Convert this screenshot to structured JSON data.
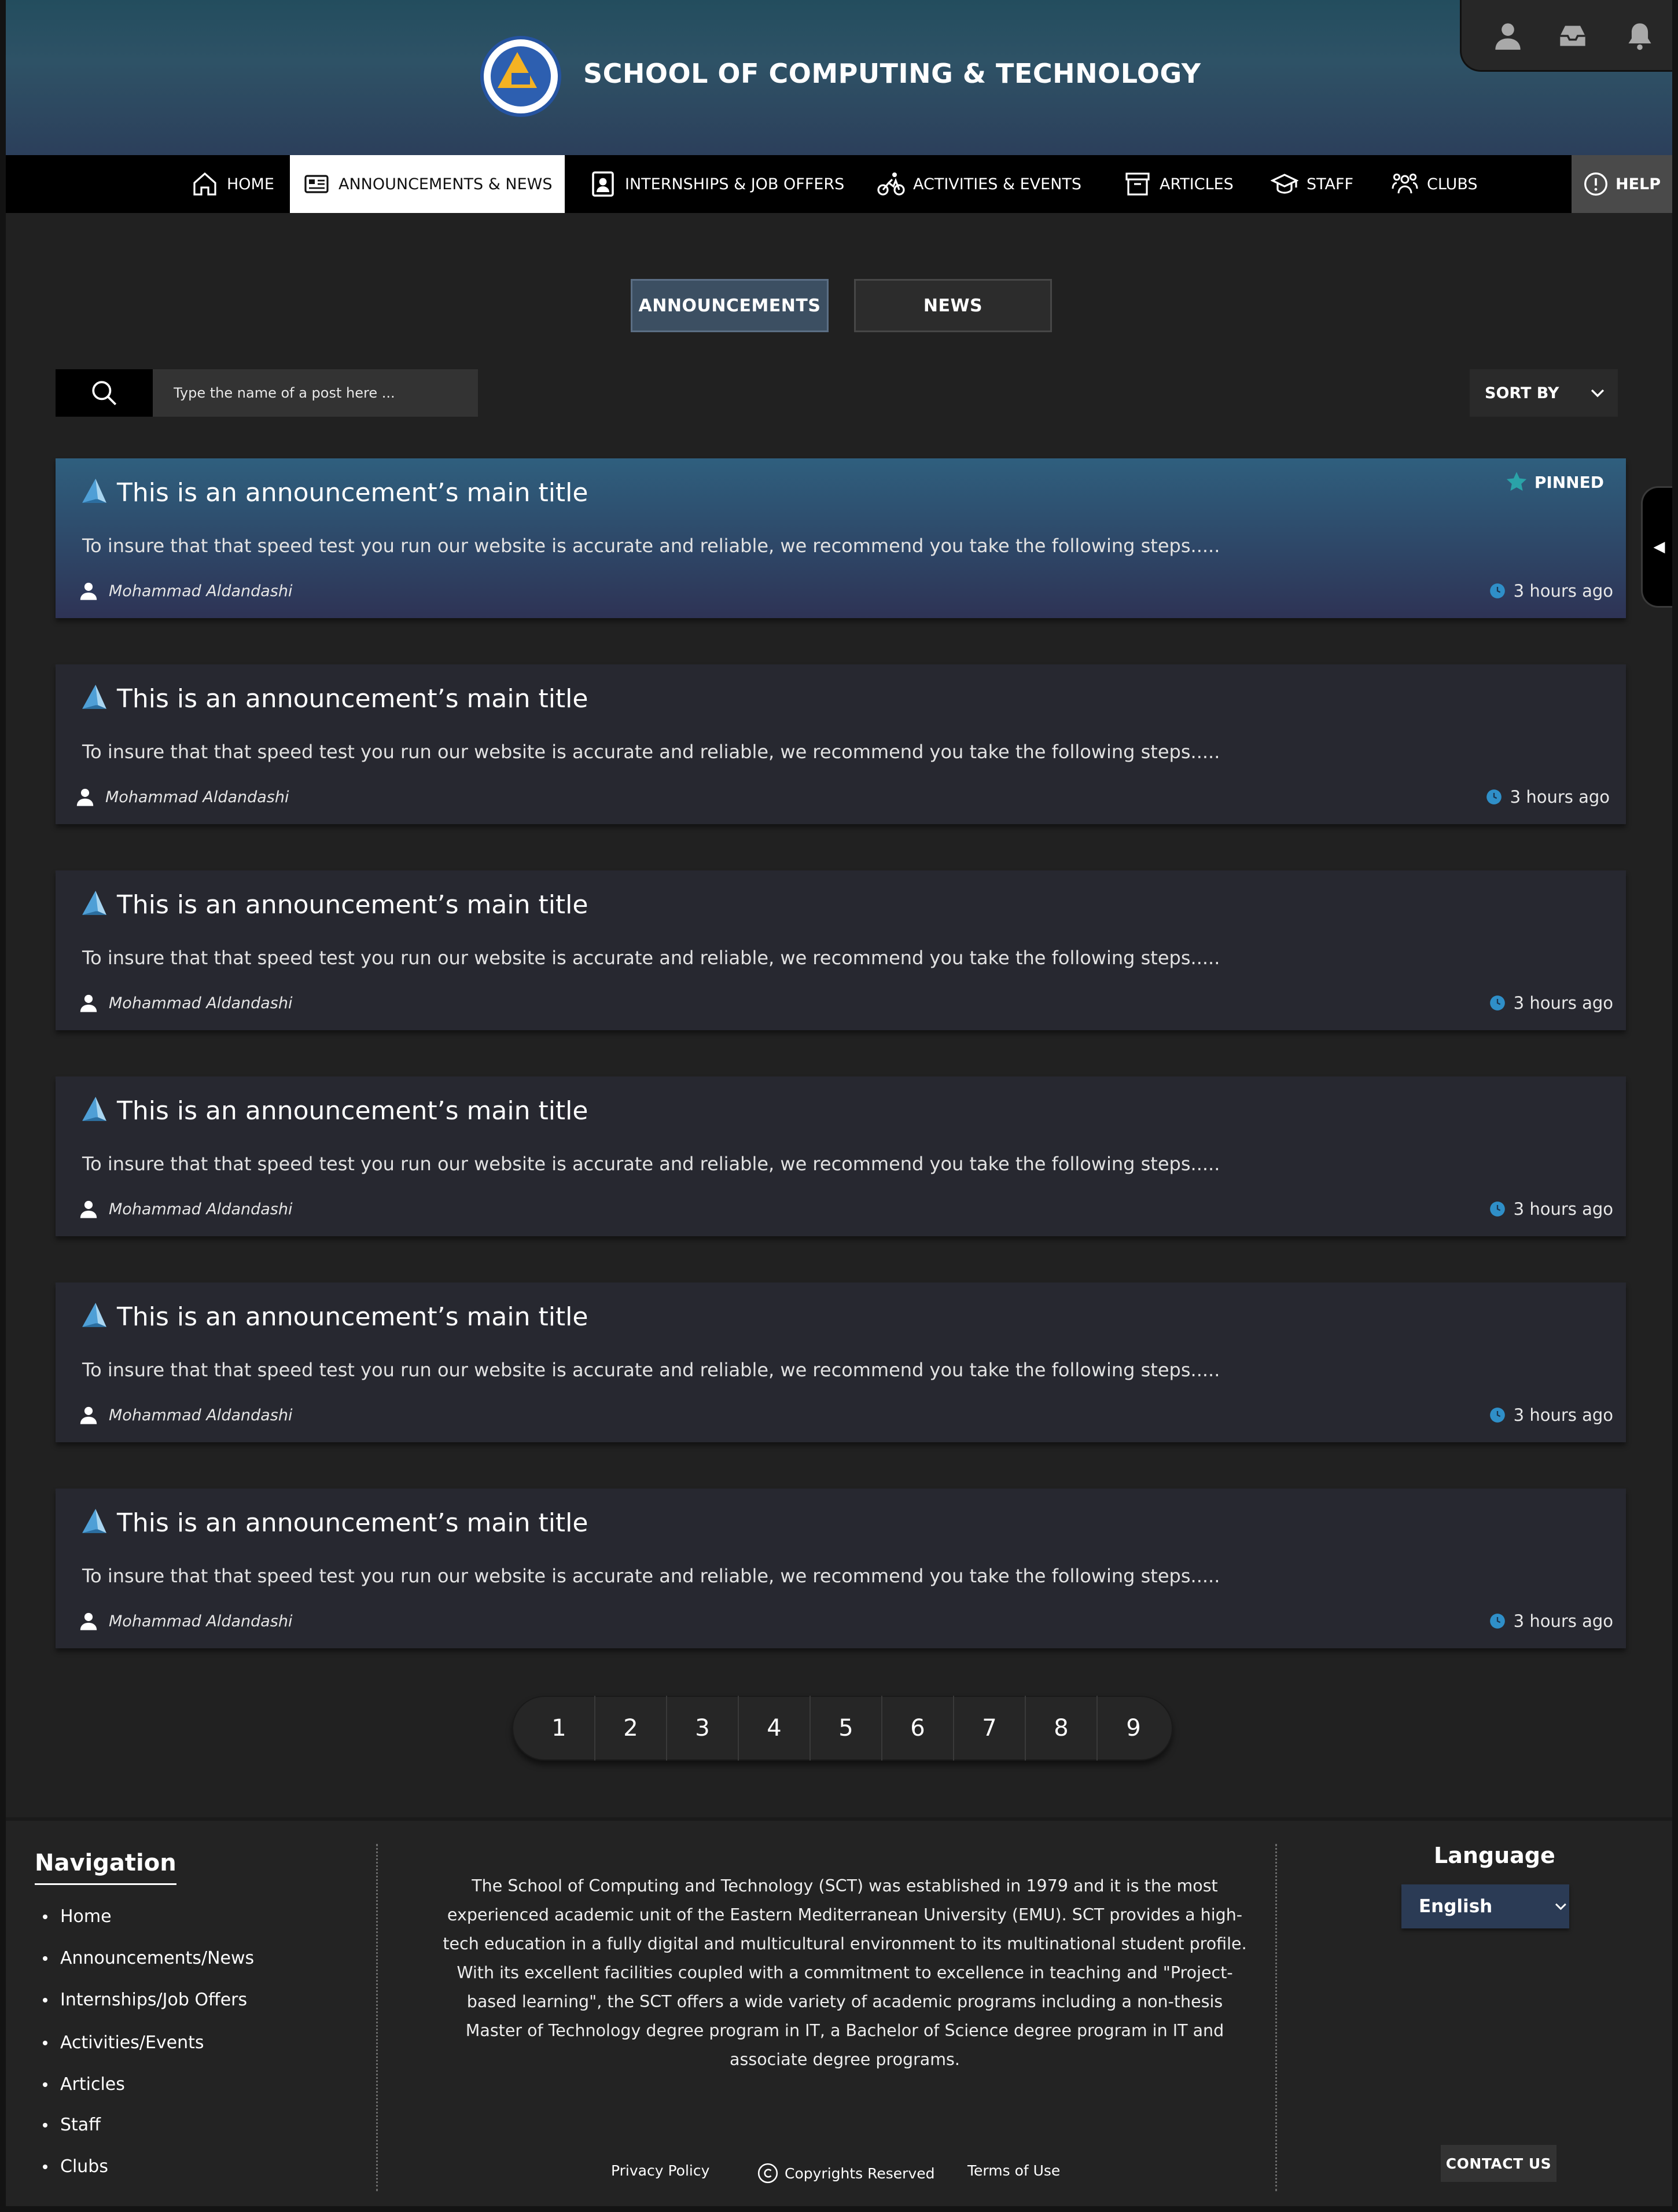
{
  "header": {
    "site_title": "SCHOOL OF COMPUTING & TECHNOLOGY",
    "logo_icon": "school-emblem-icon",
    "utility_icons": [
      "user-icon",
      "inbox-icon",
      "bell-icon"
    ]
  },
  "nav": {
    "items": [
      {
        "label": "HOME",
        "icon": "home-icon"
      },
      {
        "label": "ANNOUNCEMENTS & NEWS",
        "icon": "newspaper-icon",
        "active": true
      },
      {
        "label": "INTERNSHIPS & JOB OFFERS",
        "icon": "id-badge-icon"
      },
      {
        "label": "ACTIVITIES & EVENTS",
        "icon": "cyclist-icon"
      },
      {
        "label": "ARTICLES",
        "icon": "archive-icon"
      },
      {
        "label": "STAFF",
        "icon": "graduation-cap-icon"
      },
      {
        "label": "CLUBS",
        "icon": "group-icon"
      }
    ],
    "help_label": "HELP"
  },
  "tabs": {
    "announcements": "ANNOUNCEMENTS",
    "news": "NEWS",
    "active": "announcements"
  },
  "search": {
    "placeholder": "Type the name of a post here ...",
    "value": ""
  },
  "sort": {
    "label": "SORT BY"
  },
  "posts": [
    {
      "title": "This is an announcement’s main title",
      "body": "To insure that that speed test you run our website is accurate and reliable, we recommend you take the following steps.....",
      "author": "Mohammad Aldandashi",
      "time": "3 hours ago",
      "pinned": true,
      "pinned_label": "PINNED"
    },
    {
      "title": "This is an announcement’s main title",
      "body": "To insure that that speed test you run our website is accurate and reliable, we recommend you take the following steps.....",
      "author": "Mohammad Aldandashi",
      "time": "3 hours ago"
    },
    {
      "title": "This is an announcement’s main title",
      "body": "To insure that that speed test you run our website is accurate and reliable, we recommend you take the following steps.....",
      "author": "Mohammad Aldandashi",
      "time": "3 hours ago"
    },
    {
      "title": "This is an announcement’s main title",
      "body": "To insure that that speed test you run our website is accurate and reliable, we recommend you take the following steps.....",
      "author": "Mohammad Aldandashi",
      "time": "3 hours ago"
    },
    {
      "title": "This is an announcement’s main title",
      "body": "To insure that that speed test you run our website is accurate and reliable, we recommend you take the following steps.....",
      "author": "Mohammad Aldandashi",
      "time": "3 hours ago"
    },
    {
      "title": "This is an announcement’s main title",
      "body": "To insure that that speed test you run our website is accurate and reliable, we recommend you take the following steps.....",
      "author": "Mohammad Aldandashi",
      "time": "3 hours ago"
    }
  ],
  "pagination": {
    "pages": [
      "1",
      "2",
      "3",
      "4",
      "5",
      "6",
      "7",
      "8",
      "9"
    ]
  },
  "side_toggle": {
    "glyph": "◀"
  },
  "footer": {
    "nav_heading": "Navigation",
    "nav_links": [
      "Home",
      "Announcements/News",
      "Internships/Job Offers",
      "Activities/Events",
      "Articles",
      "Staff",
      "Clubs"
    ],
    "about": "The School of Computing and Technology (SCT) was established in 1979 and it is the most experienced academic unit of the Eastern Mediterranean University (EMU). SCT provides a high-tech education in a fully digital and multicultural environment to its multinational student profile. With its excellent facilities coupled with a commitment to excellence in teaching and \"Project-based learning\", the SCT offers a wide variety of academic programs including a non-thesis Master of Technology degree program in IT, a Bachelor of Science degree program in IT and associate degree programs.",
    "privacy": "Privacy Policy",
    "copyright": "Copyrights Reserved",
    "terms": "Terms of Use",
    "language_heading": "Language",
    "language_value": "English",
    "contact_label": "CONTACT US"
  },
  "colors": {
    "accent_blue": "#3c4f62",
    "icon_blue": "#4a9fd6",
    "pinned_star": "#2aa3a8",
    "logo_yellow": "#f4b223"
  }
}
